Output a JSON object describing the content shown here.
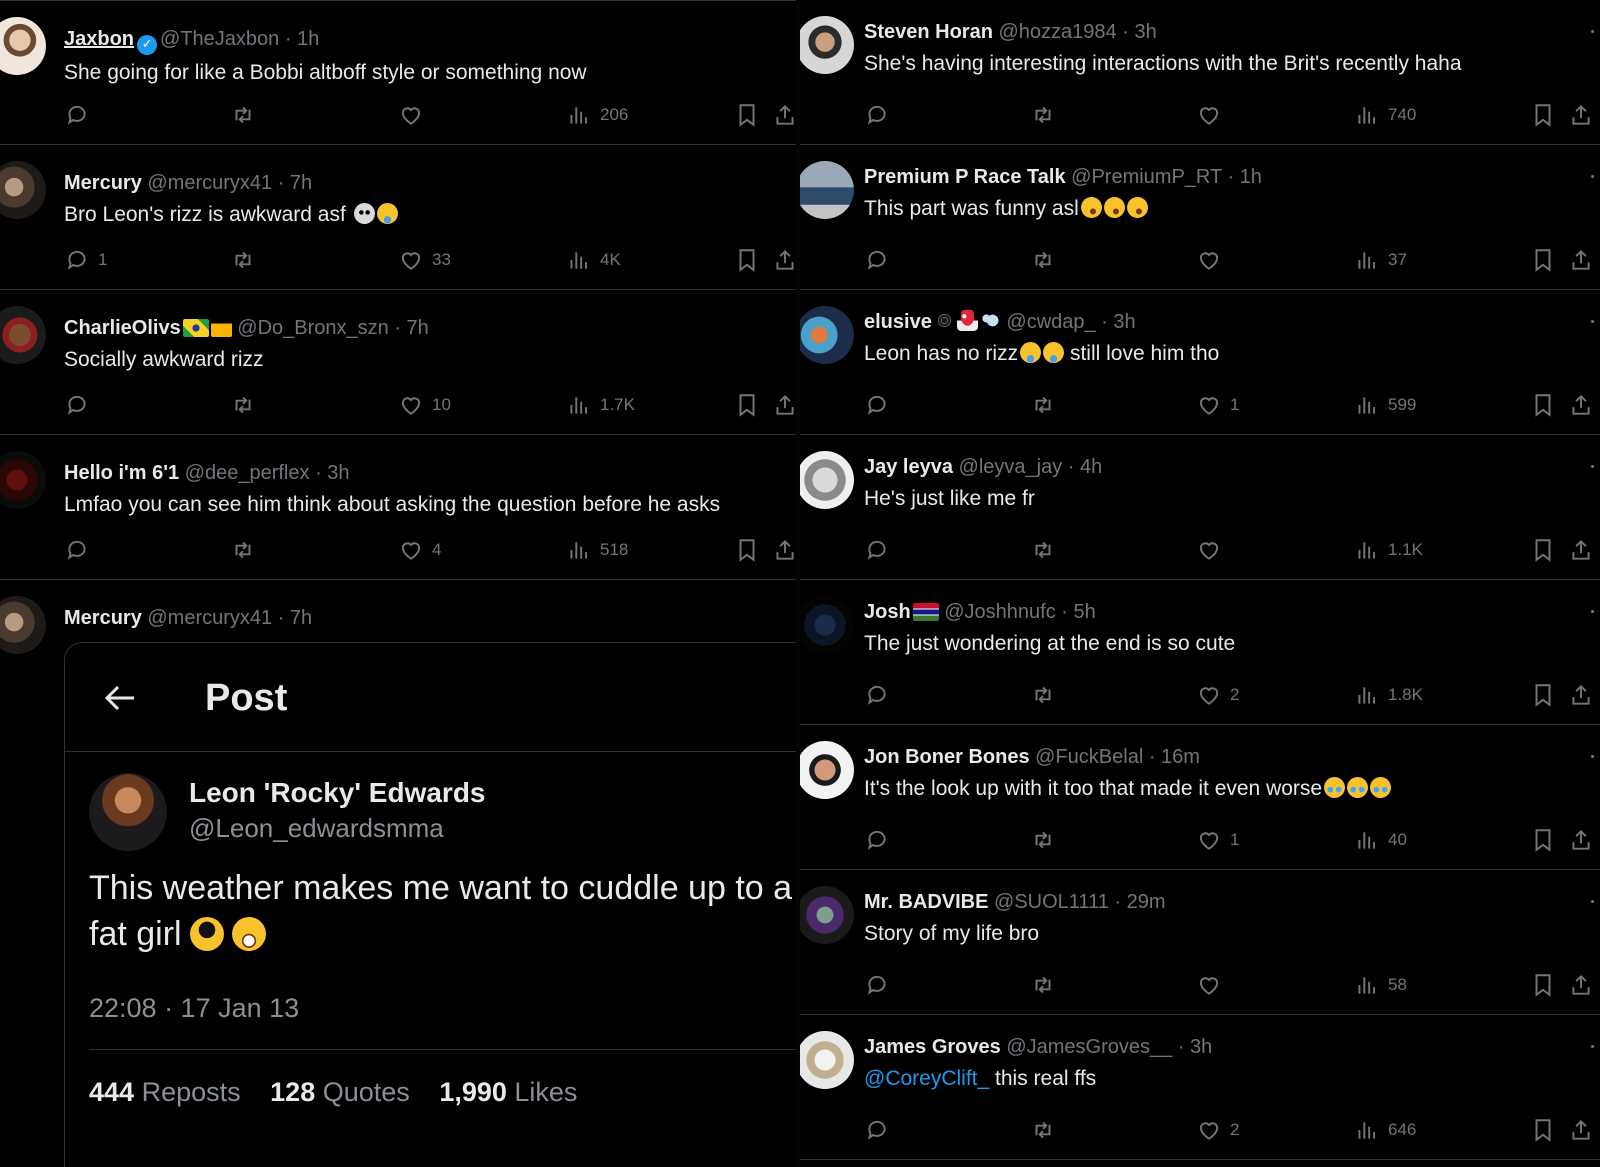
{
  "left_tweets": [
    {
      "name": "Jaxbon",
      "verified": true,
      "handle": "@TheJaxbon",
      "time": "· 1h",
      "text": "She going for like a Bobbi altboff style or something now",
      "emoji": [],
      "replies": "",
      "reposts": "",
      "likes": "",
      "views": "206"
    },
    {
      "name": "Mercury",
      "verified": false,
      "handle": "@mercuryx41",
      "time": "· 7h",
      "text": "Bro Leon's rizz is awkward asf",
      "emoji": [
        "skull",
        "joy"
      ],
      "replies": "1",
      "reposts": "",
      "likes": "33",
      "views": "4K"
    },
    {
      "name": "CharlieOlivs",
      "verified": false,
      "handle": "@Do_Bronx_szn",
      "time": "· 7h",
      "text": "Socially awkward rizz",
      "emoji": [],
      "replies": "",
      "reposts": "",
      "likes": "10",
      "views": "1.7K"
    },
    {
      "name": "Hello i'm 6'1",
      "verified": false,
      "handle": "@dee_perflex",
      "time": "· 3h",
      "text": "Lmfao you can see him think about asking the question before he asks",
      "emoji": [],
      "replies": "",
      "reposts": "",
      "likes": "4",
      "views": "518"
    }
  ],
  "quote_tweet": {
    "name": "Mercury",
    "handle": "@mercuryx41",
    "time": "· 7h",
    "card": {
      "nav_title": "Post",
      "author_name": "Leon 'Rocky' Edwards",
      "author_handle": "@Leon_edwardsmma",
      "text": "This weather makes me want to cuddle up to a fat girl",
      "meta": "22:08 · 17 Jan 13",
      "reposts_count": "444",
      "reposts_label": "Reposts",
      "quotes_count": "128",
      "quotes_label": "Quotes",
      "likes_count": "1,990",
      "likes_label": "Likes"
    }
  },
  "right_tweets": [
    {
      "name": "Steven Horan",
      "handle": "@hozza1984",
      "time": "· 3h",
      "text": "She's having interesting interactions with the Brit's recently haha",
      "mention": "",
      "emoji": [],
      "replies": "",
      "likes": "",
      "views": "740"
    },
    {
      "name": "Premium P Race Talk",
      "handle": "@PremiumP_RT",
      "time": "· 1h",
      "text": "This part was funny asl",
      "mention": "",
      "emoji": [
        "rofl",
        "rofl",
        "rofl"
      ],
      "replies": "",
      "likes": "",
      "views": "37"
    },
    {
      "name": "elusive",
      "handle": "@cwdap_",
      "time": "· 3h",
      "text": "Leon has no rizz",
      "text_after": " still love him tho",
      "mention": "",
      "emoji": [
        "joy",
        "joy"
      ],
      "replies": "",
      "likes": "1",
      "views": "599"
    },
    {
      "name": "Jay leyva",
      "handle": "@leyva_jay",
      "time": "· 4h",
      "text": "He's just like me fr",
      "mention": "",
      "emoji": [],
      "replies": "",
      "likes": "",
      "views": "1.1K"
    },
    {
      "name": "Josh",
      "handle": "@Joshhnufc",
      "time": "· 5h",
      "text": "The just wondering at the end is so cute",
      "mention": "",
      "emoji": [],
      "replies": "",
      "likes": "2",
      "views": "1.8K"
    },
    {
      "name": "Jon Boner Bones",
      "handle": "@FuckBelal",
      "time": "· 16m",
      "text": "It's the look up with it too that made it even worse",
      "mention": "",
      "emoji": [
        "sob",
        "sob",
        "sob"
      ],
      "replies": "",
      "likes": "1",
      "views": "40"
    },
    {
      "name": "Mr. BADVIBE",
      "handle": "@SUOL1111",
      "time": "· 29m",
      "text": "Story of my life bro",
      "mention": "",
      "emoji": [],
      "replies": "",
      "likes": "",
      "views": "58"
    },
    {
      "name": "James Groves",
      "handle": "@JamesGroves__",
      "time": "· 3h",
      "text": " this real ffs",
      "mention": "@CoreyClift_",
      "emoji": [],
      "replies": "",
      "likes": "2",
      "views": "646"
    }
  ],
  "colors": {
    "background": "#000000",
    "text": "#e7e9ea",
    "muted": "#71767b",
    "border": "#2f3336",
    "link": "#1d9bf0"
  },
  "icons": [
    "reply-icon",
    "retweet-icon",
    "like-icon",
    "views-icon",
    "bookmark-icon",
    "share-icon",
    "back-arrow-icon",
    "verified-badge-icon"
  ]
}
